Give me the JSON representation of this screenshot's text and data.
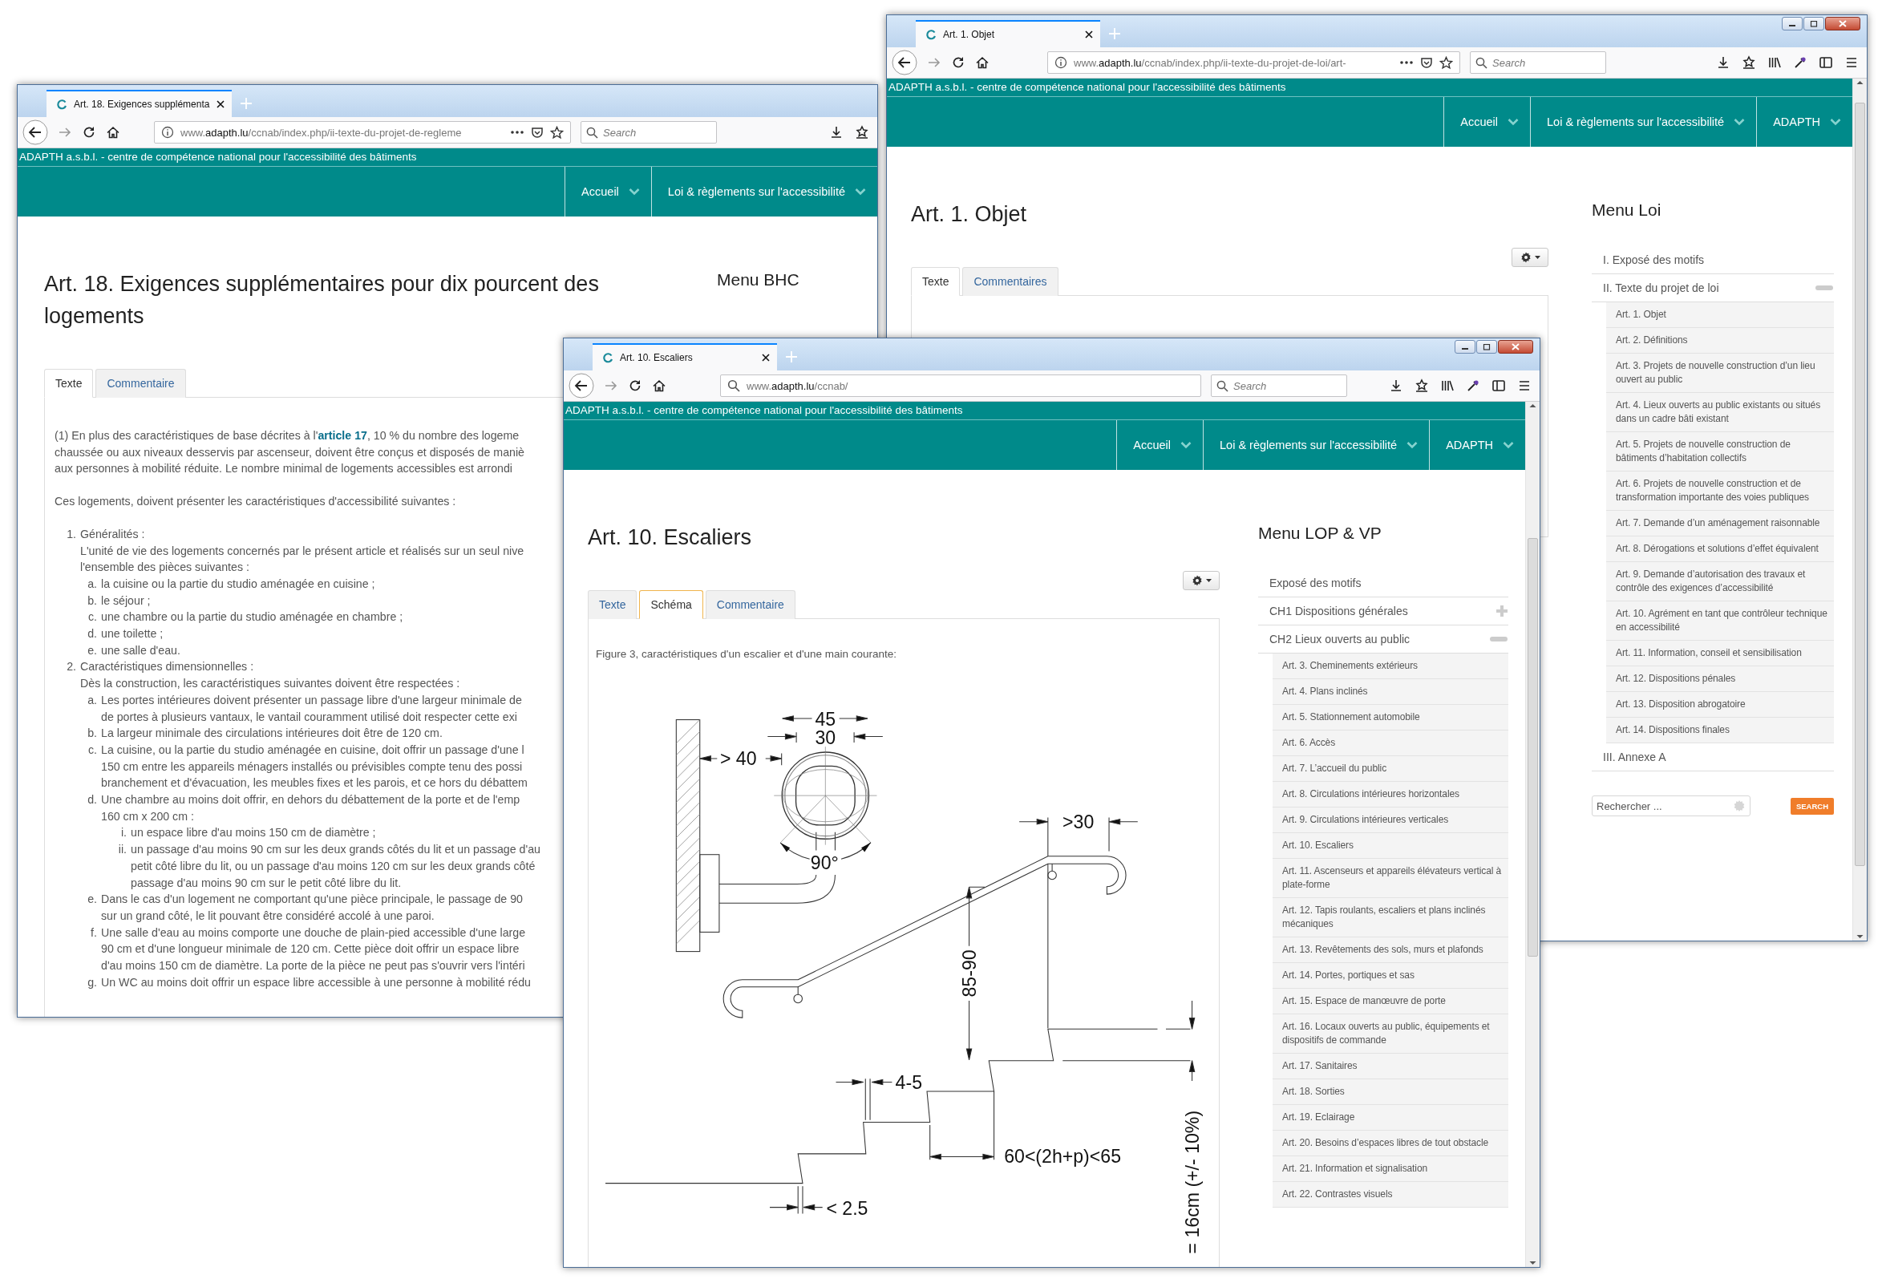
{
  "window_back_left": {
    "tab_title": "Art. 18. Exigences supplémenta",
    "url": {
      "prefix": "www.",
      "domain": "adapth.lu",
      "path": "/ccnab/index.php/ii-texte-du-projet-de-regleme"
    },
    "search_placeholder": "Search",
    "site_tagline": "ADAPTH a.s.b.l. - centre de compétence national pour l'accessibilité des bâtiments",
    "nav": [
      {
        "label": "Accueil"
      },
      {
        "label": "Loi & règlements sur l'accessibilité"
      }
    ],
    "title": "Art. 18. Exigences supplémentaires pour dix pourcent des logements",
    "tabs": [
      {
        "label": "Texte",
        "selected": true
      },
      {
        "label": "Commentaire",
        "selected": false
      }
    ],
    "lead": {
      "before": "(1) En plus des caractéristiques de base décrites à l'",
      "link": "article 17",
      "after": ", 10 % du nombre des logeme",
      "more_lines": [
        "chaussée ou aux niveaux desservis par ascenseur, doivent être conçus et disposés de maniè",
        "aux personnes à mobilité réduite. Le nombre minimal de logements accessibles est arrondi"
      ]
    },
    "note": "Ces logements, doivent présenter les caractéristiques d'accessibilité suivantes :",
    "list": [
      {
        "marker": "1.",
        "lines": [
          "Généralités :",
          "L'unité de vie des logements concernés par le présent article et réalisés sur un seul nive",
          "l'ensemble des pièces suivantes :"
        ],
        "children": [
          {
            "marker": "a.",
            "lines": [
              "la cuisine ou la partie du studio aménagée en cuisine ;"
            ]
          },
          {
            "marker": "b.",
            "lines": [
              "le séjour ;"
            ]
          },
          {
            "marker": "c.",
            "lines": [
              "une chambre ou la partie du studio aménagée en chambre ;"
            ]
          },
          {
            "marker": "d.",
            "lines": [
              "une toilette ;"
            ]
          },
          {
            "marker": "e.",
            "lines": [
              "une salle d'eau."
            ]
          }
        ]
      },
      {
        "marker": "2.",
        "lines": [
          "Caractéristiques dimensionnelles :",
          "Dès la construction, les caractéristiques suivantes doivent être respectées :"
        ],
        "children": [
          {
            "marker": "a.",
            "lines": [
              "Les portes intérieures doivent présenter un passage libre d'une largeur minimale de",
              "de portes à plusieurs vantaux, le vantail couramment utilisé doit respecter cette exi"
            ]
          },
          {
            "marker": "b.",
            "lines": [
              "La largeur minimale des circulations intérieures doit être de 120 cm."
            ]
          },
          {
            "marker": "c.",
            "lines": [
              "La cuisine, ou la partie du studio aménagée en cuisine, doit offrir un passage d'une l",
              "150 cm entre les appareils ménagers installés ou prévisibles compte tenu des possi",
              "branchement et d'évacuation, les meubles fixes et les parois, et ce hors du débattem"
            ]
          },
          {
            "marker": "d.",
            "lines": [
              "Une chambre au moins doit offrir, en dehors du débattement de la porte et de l'emp",
              "160 cm x 200 cm :"
            ],
            "children": [
              {
                "marker": "i.",
                "lines": [
                  "un espace libre d'au moins 150 cm de diamètre ;"
                ]
              },
              {
                "marker": "ii.",
                "lines": [
                  "un passage d'au moins 90 cm sur les deux grands côtés du lit et un passage d'au",
                  "petit côté libre du lit, ou un passage d'au moins 120 cm sur les deux grands côté",
                  "passage d'au moins 90 cm sur le petit côté libre du lit."
                ]
              }
            ]
          },
          {
            "marker": "e.",
            "lines": [
              "Dans le cas d'un logement ne comportant qu'une pièce principale, le passage de 90",
              "sur un grand côté, le lit pouvant être considéré accolé à une paroi."
            ]
          },
          {
            "marker": "f.",
            "lines": [
              "Une salle d'eau au moins comporte une douche de plain-pied accessible d'une large",
              "90 cm et d'une longueur minimale de 120 cm. Cette pièce doit offrir un espace libre",
              "d'au moins 150 cm de diamètre. La porte de la pièce ne peut pas s'ouvrir vers l'intéri"
            ]
          },
          {
            "marker": "g.",
            "lines": [
              "Un WC au moins doit offrir un espace libre accessible à une personne à mobilité rédu"
            ]
          }
        ]
      }
    ],
    "menu_title": "Menu BHC"
  },
  "window_back_right": {
    "tab_title": "Art. 1. Objet",
    "url": {
      "prefix": "www.",
      "domain": "adapth.lu",
      "path": "/ccnab/index.php/ii-texte-du-projet-de-loi/art-"
    },
    "search_placeholder": "Search",
    "site_tagline": "ADAPTH a.s.b.l. - centre de compétence national pour l'accessibilité des bâtiments",
    "nav": [
      {
        "label": "Accueil"
      },
      {
        "label": "Loi & règlements sur l'accessibilité"
      },
      {
        "label": "ADAPTH"
      }
    ],
    "title": "Art. 1. Objet",
    "tabs": [
      {
        "label": "Texte",
        "selected": true
      },
      {
        "label": "Commentaires",
        "selected": false
      }
    ],
    "menu_title": "Menu Loi",
    "menu": [
      {
        "kind": "link",
        "label": "I. Exposé des motifs"
      },
      {
        "kind": "group",
        "label": "II. Texte du projet de loi",
        "expanded": true,
        "children": [
          {
            "label": "Art. 1. Objet"
          },
          {
            "label": "Art. 2. Définitions"
          },
          {
            "label": "Art. 3. Projets de nouvelle construction d’un lieu ouvert au public"
          },
          {
            "label": "Art. 4. Lieux ouverts au public existants ou situés dans un cadre bâti existant"
          },
          {
            "label": "Art. 5. Projets de nouvelle construction de bâtiments d’habitation collectifs"
          },
          {
            "label": "Art. 6. Projets de nouvelle construction et de transformation importante des voies publiques"
          },
          {
            "label": "Art. 7. Demande d’un aménagement raisonnable"
          },
          {
            "label": "Art. 8. Dérogations et solutions d’effet équivalent"
          },
          {
            "label": "Art. 9. Demande d’autorisation des travaux et contrôle des exigences d’accessibilité"
          },
          {
            "label": "Art. 10. Agrément en tant que contrôleur technique en accessibilité"
          },
          {
            "label": "Art. 11. Information, conseil et sensibilisation"
          },
          {
            "label": "Art. 12. Dispositions pénales"
          },
          {
            "label": "Art. 13. Disposition abrogatoire"
          },
          {
            "label": "Art. 14. Dispositions finales"
          }
        ]
      },
      {
        "kind": "link",
        "label": "III. Annexe A"
      }
    ],
    "sidebar_search": {
      "placeholder": "Rechercher ...",
      "button": "SEARCH"
    }
  },
  "window_front": {
    "tab_title": "Art. 10. Escaliers",
    "url": {
      "prefix": "www.",
      "domain": "adapth.lu",
      "path": "/ccnab/"
    },
    "search_placeholder": "Search",
    "site_tagline": "ADAPTH a.s.b.l. - centre de compétence national pour l'accessibilité des bâtiments",
    "nav": [
      {
        "label": "Accueil"
      },
      {
        "label": "Loi & règlements sur l'accessibilité"
      },
      {
        "label": "ADAPTH"
      }
    ],
    "title": "Art. 10. Escaliers",
    "tabs": [
      {
        "label": "Texte",
        "selected": false
      },
      {
        "label": "Schéma",
        "selected": true
      },
      {
        "label": "Commentaire",
        "selected": false
      }
    ],
    "figure_caption": "Figure 3, caractéristiques d'un escalier et d'une main courante:",
    "figure_labels": [
      "45",
      "30",
      "> 40",
      "90°",
      ">30",
      "85-90",
      "4-5",
      "60<(2h+p)<65",
      "< 2.5",
      "= 16cm (+/- 10%)"
    ],
    "menu_title": "Menu LOP & VP",
    "menu": [
      {
        "kind": "link",
        "label": "Exposé des motifs"
      },
      {
        "kind": "group",
        "label": "CH1 Dispositions générales",
        "expanded": false
      },
      {
        "kind": "group",
        "label": "CH2 Lieux ouverts au public",
        "expanded": true,
        "children": [
          {
            "label": "Art. 3. Cheminements extérieurs"
          },
          {
            "label": "Art. 4. Plans inclinés"
          },
          {
            "label": "Art. 5. Stationnement automobile"
          },
          {
            "label": "Art. 6. Accès"
          },
          {
            "label": "Art. 7. L’accueil du public"
          },
          {
            "label": "Art. 8. Circulations intérieures horizontales"
          },
          {
            "label": "Art. 9. Circulations intérieures verticales"
          },
          {
            "label": "Art. 10. Escaliers"
          },
          {
            "label": "Art. 11. Ascenseurs et appareils élévateurs vertical à plate-forme"
          },
          {
            "label": "Art. 12. Tapis roulants, escaliers et plans inclinés mécaniques"
          },
          {
            "label": "Art. 13. Revêtements des sols, murs et plafonds"
          },
          {
            "label": "Art. 14. Portes, portiques et sas"
          },
          {
            "label": "Art. 15. Espace de manœuvre de porte"
          },
          {
            "label": "Art. 16. Locaux ouverts au public, équipements et dispositifs de commande"
          },
          {
            "label": "Art. 17. Sanitaires"
          },
          {
            "label": "Art. 18. Sorties"
          },
          {
            "label": "Art. 19. Eclairage"
          },
          {
            "label": "Art. 20. Besoins d’espaces libres de tout obstacle"
          },
          {
            "label": "Art. 21. Information et signalisation"
          },
          {
            "label": "Art. 22. Contrastes visuels"
          }
        ]
      }
    ]
  }
}
